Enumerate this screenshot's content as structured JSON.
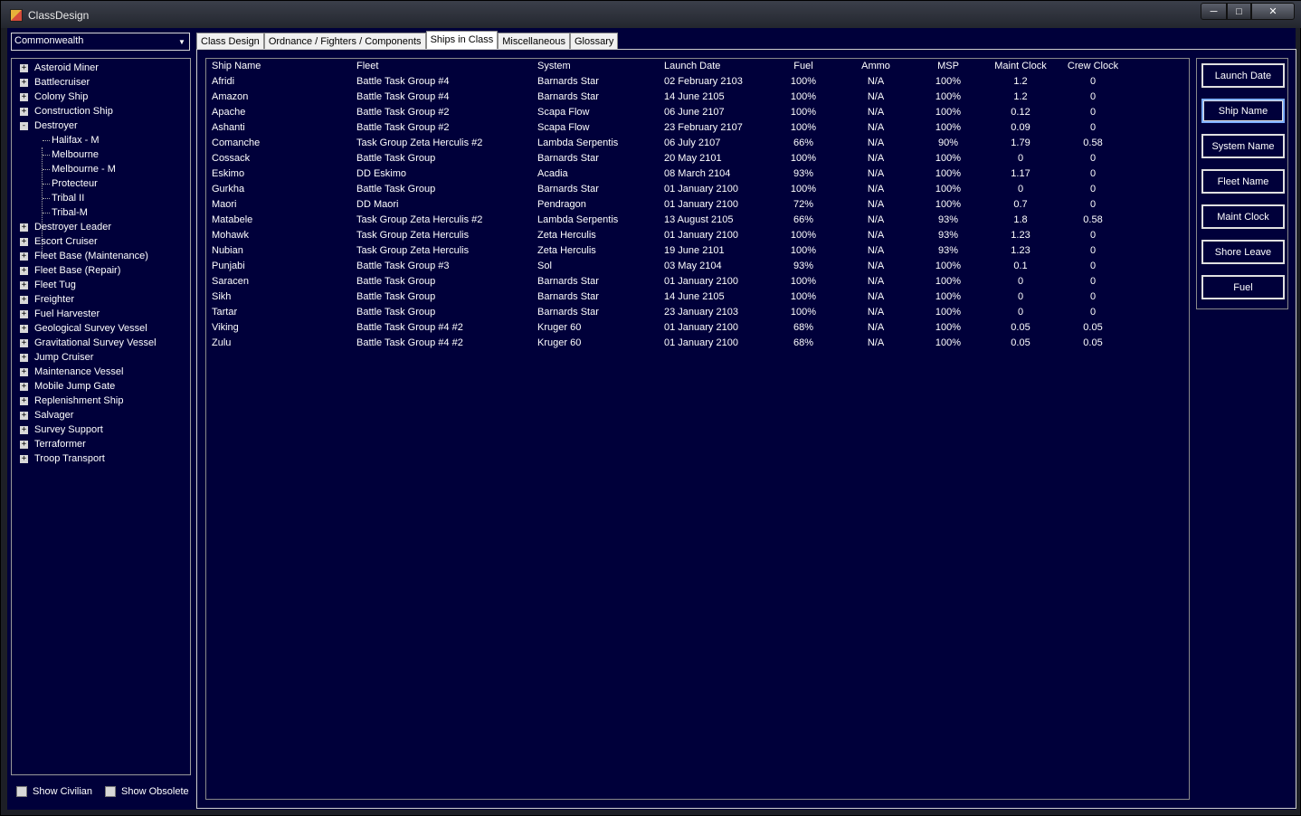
{
  "window": {
    "title": "ClassDesign"
  },
  "race_select": {
    "value": "Commonwealth"
  },
  "tree": {
    "items": [
      {
        "label": "Asteroid Miner",
        "expander": "+"
      },
      {
        "label": "Battlecruiser",
        "expander": "+"
      },
      {
        "label": "Colony Ship",
        "expander": "+"
      },
      {
        "label": "Construction Ship",
        "expander": "+"
      },
      {
        "label": "Destroyer",
        "expander": "-"
      },
      {
        "label": "Halifax - M",
        "child": true
      },
      {
        "label": "Melbourne",
        "child": true
      },
      {
        "label": "Melbourne - M",
        "child": true
      },
      {
        "label": "Protecteur",
        "child": true
      },
      {
        "label": "Tribal II",
        "child": true
      },
      {
        "label": "Tribal-M",
        "child": true
      },
      {
        "label": "Destroyer Leader",
        "expander": "+"
      },
      {
        "label": "Escort Cruiser",
        "expander": "+"
      },
      {
        "label": "Fleet Base (Maintenance)",
        "expander": "+"
      },
      {
        "label": "Fleet Base (Repair)",
        "expander": "+"
      },
      {
        "label": "Fleet Tug",
        "expander": "+"
      },
      {
        "label": "Freighter",
        "expander": "+"
      },
      {
        "label": "Fuel Harvester",
        "expander": "+"
      },
      {
        "label": "Geological Survey Vessel",
        "expander": "+"
      },
      {
        "label": "Gravitational Survey Vessel",
        "expander": "+"
      },
      {
        "label": "Jump Cruiser",
        "expander": "+"
      },
      {
        "label": "Maintenance Vessel",
        "expander": "+"
      },
      {
        "label": "Mobile Jump Gate",
        "expander": "+"
      },
      {
        "label": "Replenishment Ship",
        "expander": "+"
      },
      {
        "label": "Salvager",
        "expander": "+"
      },
      {
        "label": "Survey Support",
        "expander": "+"
      },
      {
        "label": "Terraformer",
        "expander": "+"
      },
      {
        "label": "Troop Transport",
        "expander": "+"
      }
    ]
  },
  "checkboxes": {
    "show_civilian": "Show Civilian",
    "show_obsolete": "Show Obsolete"
  },
  "tabs": [
    "Class Design",
    "Ordnance / Fighters / Components",
    "Ships in Class",
    "Miscellaneous",
    "Glossary"
  ],
  "active_tab": "Ships in Class",
  "table": {
    "headers": [
      "Ship Name",
      "Fleet",
      "System",
      "Launch Date",
      "Fuel",
      "Ammo",
      "MSP",
      "Maint Clock",
      "Crew Clock"
    ],
    "rows": [
      [
        "Afridi",
        "Battle Task Group #4",
        "Barnards Star",
        "02 February 2103",
        "100%",
        "N/A",
        "100%",
        "1.2",
        "0"
      ],
      [
        "Amazon",
        "Battle Task Group #4",
        "Barnards Star",
        "14 June 2105",
        "100%",
        "N/A",
        "100%",
        "1.2",
        "0"
      ],
      [
        "Apache",
        "Battle Task Group #2",
        "Scapa Flow",
        "06 June 2107",
        "100%",
        "N/A",
        "100%",
        "0.12",
        "0"
      ],
      [
        "Ashanti",
        "Battle Task Group #2",
        "Scapa Flow",
        "23 February 2107",
        "100%",
        "N/A",
        "100%",
        "0.09",
        "0"
      ],
      [
        "Comanche",
        "Task Group Zeta Herculis #2",
        "Lambda Serpentis",
        "06 July 2107",
        "66%",
        "N/A",
        "90%",
        "1.79",
        "0.58"
      ],
      [
        "Cossack",
        "Battle Task Group",
        "Barnards Star",
        "20 May 2101",
        "100%",
        "N/A",
        "100%",
        "0",
        "0"
      ],
      [
        "Eskimo",
        "DD Eskimo",
        "Acadia",
        "08 March 2104",
        "93%",
        "N/A",
        "100%",
        "1.17",
        "0"
      ],
      [
        "Gurkha",
        "Battle Task Group",
        "Barnards Star",
        "01 January 2100",
        "100%",
        "N/A",
        "100%",
        "0",
        "0"
      ],
      [
        "Maori",
        "DD Maori",
        "Pendragon",
        "01 January 2100",
        "72%",
        "N/A",
        "100%",
        "0.7",
        "0"
      ],
      [
        "Matabele",
        "Task Group Zeta Herculis #2",
        "Lambda Serpentis",
        "13 August 2105",
        "66%",
        "N/A",
        "93%",
        "1.8",
        "0.58"
      ],
      [
        "Mohawk",
        "Task Group Zeta Herculis",
        "Zeta Herculis",
        "01 January 2100",
        "100%",
        "N/A",
        "93%",
        "1.23",
        "0"
      ],
      [
        "Nubian",
        "Task Group Zeta Herculis",
        "Zeta Herculis",
        "19 June 2101",
        "100%",
        "N/A",
        "93%",
        "1.23",
        "0"
      ],
      [
        "Punjabi",
        "Battle Task Group #3",
        "Sol",
        "03 May 2104",
        "93%",
        "N/A",
        "100%",
        "0.1",
        "0"
      ],
      [
        "Saracen",
        "Battle Task Group",
        "Barnards Star",
        "01 January 2100",
        "100%",
        "N/A",
        "100%",
        "0",
        "0"
      ],
      [
        "Sikh",
        "Battle Task Group",
        "Barnards Star",
        "14 June 2105",
        "100%",
        "N/A",
        "100%",
        "0",
        "0"
      ],
      [
        "Tartar",
        "Battle Task Group",
        "Barnards Star",
        "23 January 2103",
        "100%",
        "N/A",
        "100%",
        "0",
        "0"
      ],
      [
        "Viking",
        "Battle Task Group #4 #2",
        "Kruger 60",
        "01 January 2100",
        "68%",
        "N/A",
        "100%",
        "0.05",
        "0.05"
      ],
      [
        "Zulu",
        "Battle Task Group #4 #2",
        "Kruger 60",
        "01 January 2100",
        "68%",
        "N/A",
        "100%",
        "0.05",
        "0.05"
      ]
    ]
  },
  "sort_buttons": [
    "Launch Date",
    "Ship Name",
    "System Name",
    "Fleet Name",
    "Maint Clock",
    "Shore Leave",
    "Fuel"
  ]
}
